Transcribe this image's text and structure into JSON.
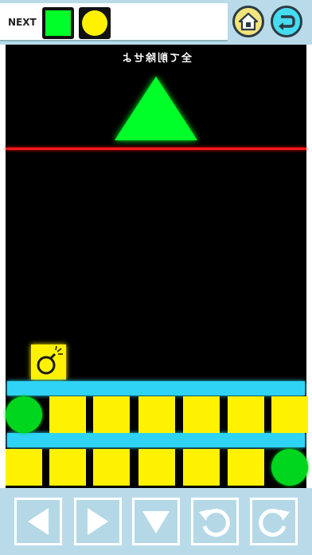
{
  "header": {
    "next_label": "NEXT",
    "next_pieces": [
      "square-green",
      "circle-yellow"
    ],
    "home_button": "home-icon",
    "back_button": "return-icon"
  },
  "board": {
    "caption": "全て削除せよ",
    "target_shape": "triangle-green",
    "limit_line_color": "#ff1a1a",
    "piece_colors": {
      "yellow": "#fff200",
      "green": "#00d61e",
      "bar": "#2ed3f5"
    }
  },
  "controls": [
    "left-arrow-icon",
    "right-arrow-icon",
    "down-arrow-icon",
    "rotate-left-icon",
    "rotate-right-icon"
  ]
}
